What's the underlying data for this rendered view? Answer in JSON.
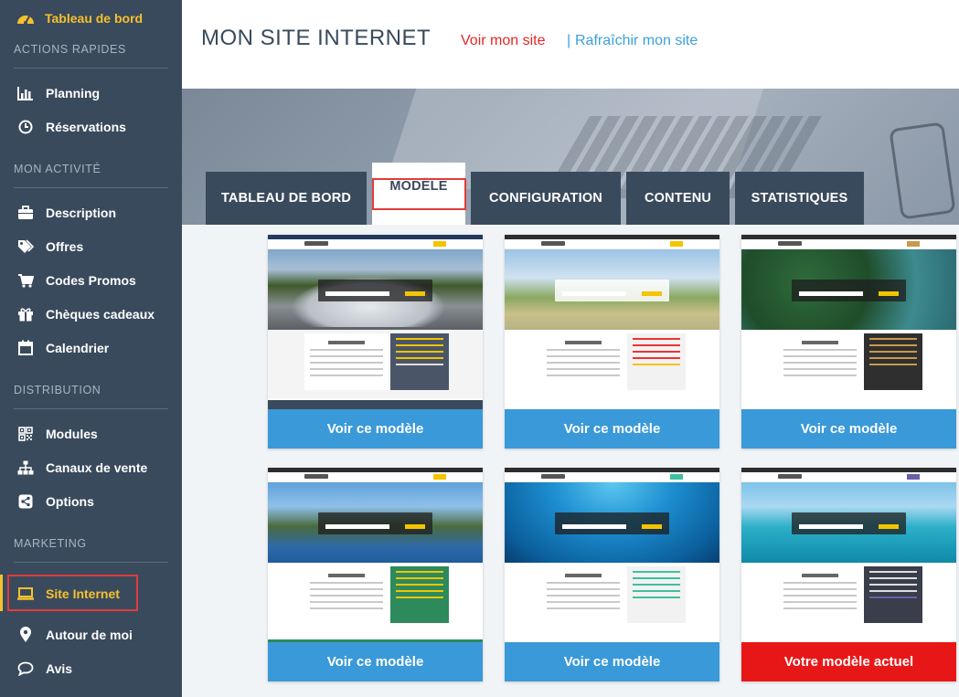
{
  "sidebar": {
    "dashboard": "Tableau de bord",
    "sections": [
      {
        "title": "ACTIONS RAPIDES",
        "items": [
          "Planning",
          "Réservations"
        ]
      },
      {
        "title": "MON ACTIVITÉ",
        "items": [
          "Description",
          "Offres",
          "Codes Promos",
          "Chèques cadeaux",
          "Calendrier"
        ]
      },
      {
        "title": "DISTRIBUTION",
        "items": [
          "Modules",
          "Canaux de vente",
          "Options"
        ]
      },
      {
        "title": "MARKETING",
        "items": [
          "Site Internet",
          "Autour de moi",
          "Avis"
        ]
      }
    ],
    "active_item": "Site Internet"
  },
  "header": {
    "title": "MON SITE INTERNET",
    "link_view": "Voir mon site",
    "separator": "|",
    "link_refresh": "Rafraîchir mon site"
  },
  "tabs": [
    "TABLEAU DE BORD",
    "MODÈLE",
    "CONFIGURATION",
    "CONTENU",
    "STATISTIQUES"
  ],
  "active_tab": "MODÈLE",
  "templates": [
    {
      "button": "Voir ce modèle",
      "current": false
    },
    {
      "button": "Voir ce modèle",
      "current": false
    },
    {
      "button": "Voir ce modèle",
      "current": false
    },
    {
      "button": "Voir ce modèle",
      "current": false
    },
    {
      "button": "Voir ce modèle",
      "current": false
    },
    {
      "button": "Votre modèle actuel",
      "current": true
    }
  ],
  "colors": {
    "sidebar_bg": "#3a4a5d",
    "accent_yellow": "#f6c12d",
    "button_blue": "#3a99d8",
    "button_current_red": "#e81717",
    "highlight_red": "#e23b3b",
    "link_red": "#e32727",
    "link_blue": "#3ca0dc"
  }
}
